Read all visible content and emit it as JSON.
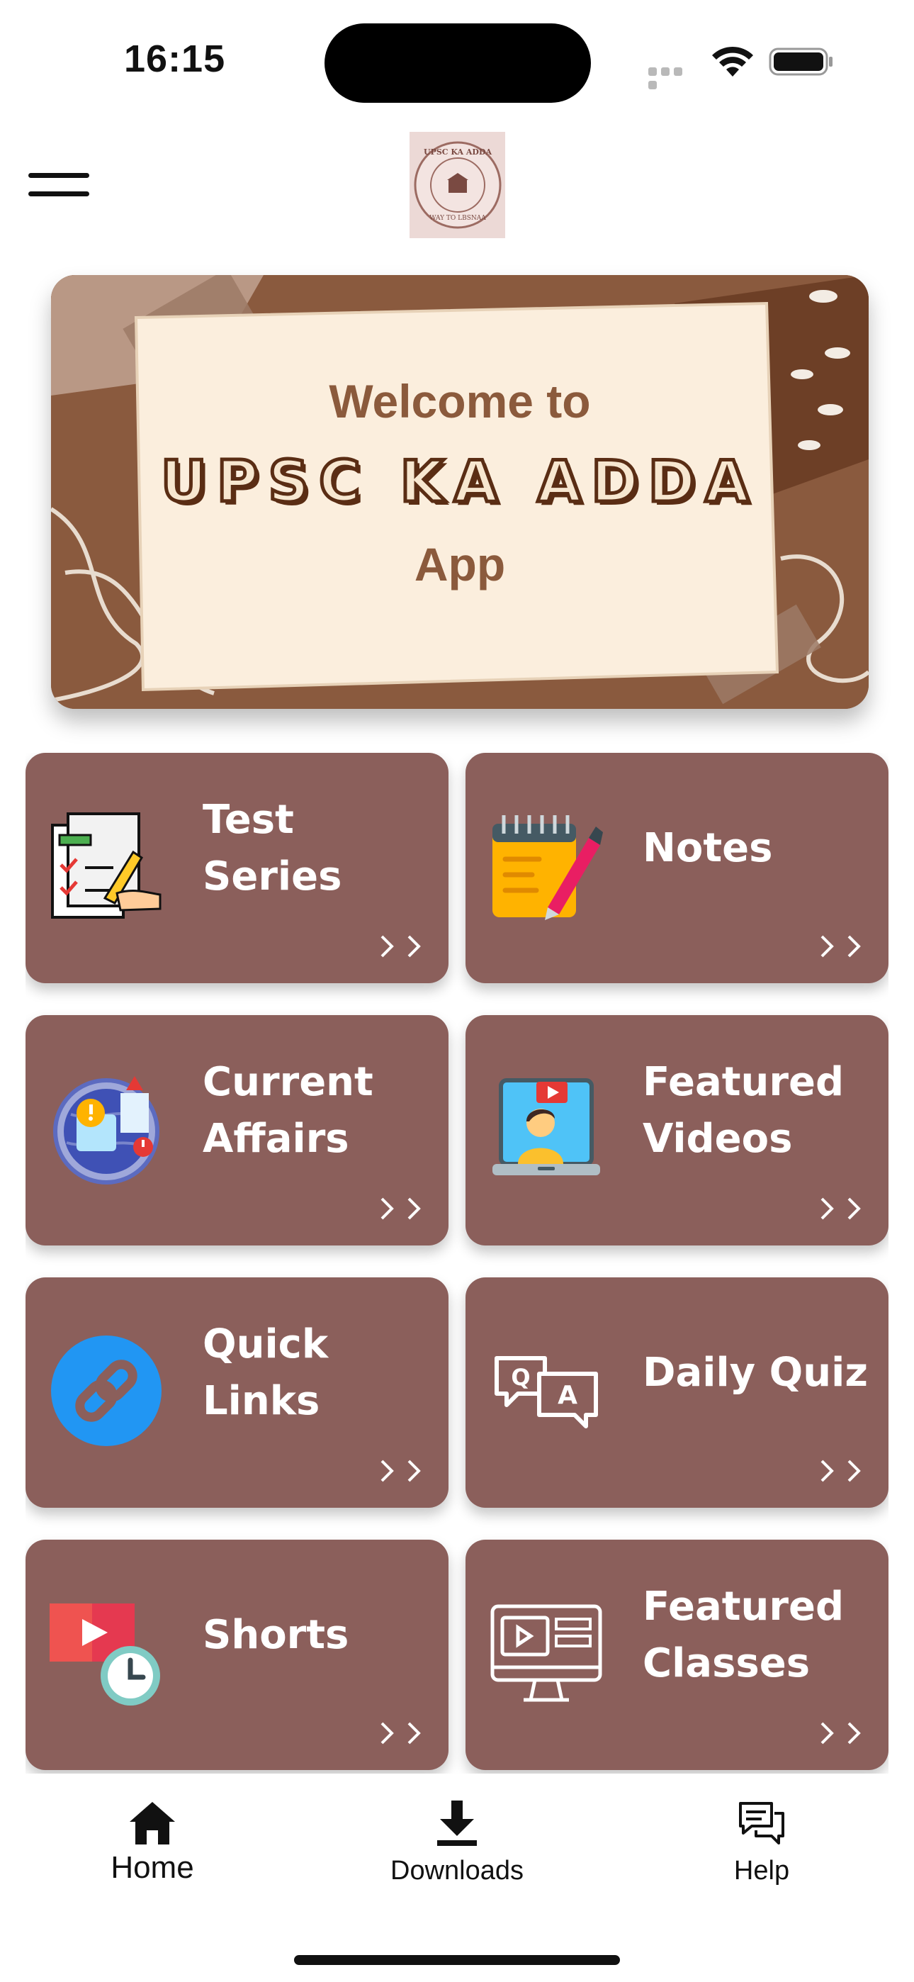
{
  "status_bar": {
    "time": "16:15"
  },
  "header": {
    "logo_top_text": "UPSC KA ADDA",
    "logo_bottom_text": "WAY TO LBSNAA"
  },
  "banner": {
    "line1": "Welcome to",
    "line2": "UPSC KA ADDA",
    "line3": "App"
  },
  "tiles": [
    {
      "label": "Test Series",
      "icon": "test-series-icon"
    },
    {
      "label": "Notes",
      "icon": "notes-icon"
    },
    {
      "label": "Current\nAffairs",
      "icon": "current-affairs-icon"
    },
    {
      "label": "Featured\nVideos",
      "icon": "featured-videos-icon"
    },
    {
      "label": "Quick\nLinks",
      "icon": "link-icon"
    },
    {
      "label": "Daily Quiz",
      "icon": "quiz-icon"
    },
    {
      "label": "Shorts",
      "icon": "shorts-icon"
    },
    {
      "label": "Featured\nClasses",
      "icon": "featured-classes-icon"
    }
  ],
  "bottom_nav": [
    {
      "label": "Home",
      "icon": "home-icon"
    },
    {
      "label": "Downloads",
      "icon": "download-icon"
    },
    {
      "label": "Help",
      "icon": "chat-icon"
    }
  ],
  "colors": {
    "tile_bg": "#8b5f5b",
    "banner_bg": "#8a5a3e",
    "paper": "#fbeedd"
  }
}
